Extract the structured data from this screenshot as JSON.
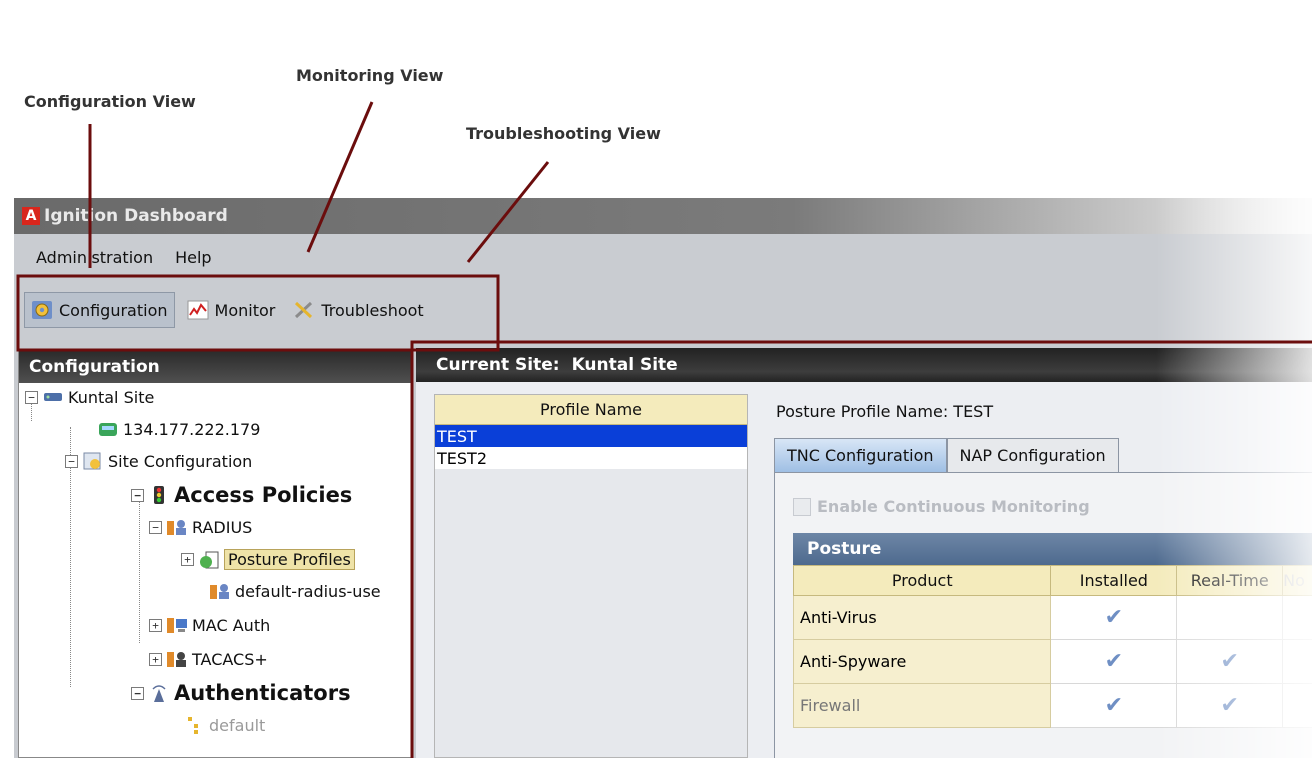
{
  "callouts": {
    "configuration_view": "Configuration View",
    "monitoring_view": "Monitoring View",
    "troubleshooting_view": "Troubleshooting View"
  },
  "window": {
    "title": "Ignition Dashboard",
    "logo_letter": "A"
  },
  "menu": {
    "administration": "Administration",
    "help": "Help"
  },
  "toolbar": {
    "configuration": "Configuration",
    "monitor": "Monitor",
    "troubleshoot": "Troubleshoot"
  },
  "left_panel": {
    "header": "Configuration",
    "tree": {
      "site": "Kuntal Site",
      "ip": "134.177.222.179",
      "site_config": "Site Configuration",
      "access_policies": "Access Policies",
      "radius": "RADIUS",
      "posture_profiles": "Posture Profiles",
      "default_radius": "default-radius-use",
      "mac_auth": "MAC Auth",
      "tacacs": "TACACS+",
      "authenticators": "Authenticators",
      "default": "default"
    }
  },
  "right_panel": {
    "current_site_label": "Current Site:",
    "current_site_value": "Kuntal Site",
    "profile_list": {
      "header": "Profile Name",
      "rows": [
        "TEST",
        "TEST2"
      ],
      "selected_index": 0
    },
    "posture_profile_name": "Posture Profile Name: TEST",
    "tabs": [
      "TNC Configuration",
      "NAP Configuration"
    ],
    "active_tab": 0,
    "enable_monitoring_label": "Enable Continuous Monitoring",
    "enable_monitoring_checked": false,
    "posture_section": "Posture",
    "posture_table": {
      "columns": [
        "Product",
        "Installed",
        "Real-Time",
        "No"
      ],
      "rows": [
        {
          "product": "Anti-Virus",
          "installed": true,
          "realtime": false
        },
        {
          "product": "Anti-Spyware",
          "installed": true,
          "realtime": true
        },
        {
          "product": "Firewall",
          "installed": true,
          "realtime": true
        }
      ]
    }
  },
  "colors": {
    "highlight_box": "#6b0d0d",
    "selection": "#0a3fd8",
    "table_header": "#f4ebbc"
  }
}
